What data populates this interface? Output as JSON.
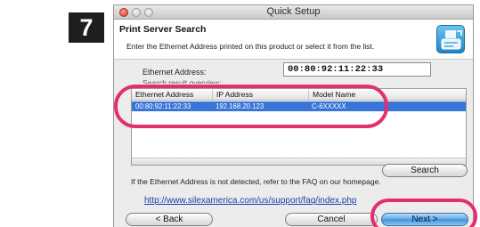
{
  "step": {
    "number": "7"
  },
  "window": {
    "title": "Quick Setup",
    "heading": "Print Server Search",
    "instruction": "Enter the Ethernet Address printed on this product or select it from the list."
  },
  "ethernet_field": {
    "label": "Ethernet Address:",
    "value": "00:80:92:11:22:33"
  },
  "results_caption": "Search result overview:",
  "results_table": {
    "columns": [
      "Ethernet Address",
      "IP Address",
      "Model Name"
    ],
    "rows": [
      {
        "ethernet": "00:80:92:11:22:33",
        "ip": "192.168.20.123",
        "model": "C-6XXXXX",
        "selected": true
      }
    ]
  },
  "buttons": {
    "search": "Search",
    "back": "< Back",
    "cancel": "Cancel",
    "next": "Next >"
  },
  "help_text": "If the Ethernet Address is not detected, refer to the FAQ on our homepage.",
  "faq_link": "http://www.silexamerica.com/us/support/faq/index.php",
  "colors": {
    "selection": "#3875d7",
    "callout": "#e2306e",
    "link": "#1a3fa8",
    "primary_button": "#5aa6e8"
  }
}
